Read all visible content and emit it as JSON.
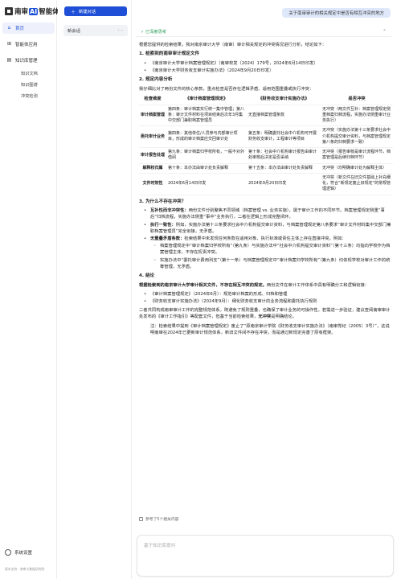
{
  "app": {
    "logo_prefix": "南审",
    "logo_a": "AI",
    "logo_suffix": "智能体"
  },
  "sidebar": {
    "nav": [
      {
        "label": "首页",
        "icon": "home-icon"
      },
      {
        "label": "智能体应用",
        "icon": "apps-icon"
      },
      {
        "label": "知识库管理",
        "icon": "knowledge-icon"
      }
    ],
    "subnav": [
      "知识文档",
      "知识图谱",
      "冲突检测"
    ],
    "settings_label": "系统设置",
    "footer_note": "版本支持：南审大数据研究院"
  },
  "conversations": {
    "new_chat_label": "新建对话",
    "items": [
      {
        "title": "新会话",
        "more": "···"
      }
    ]
  },
  "chat": {
    "user_message": "关于南审审计的相关规定中是否有相互冲突的地方",
    "thinking_label": "已深度思考",
    "intro": "根据您提供的检索结果，我对南京审计大学（南审）审计相关规定的冲突情况进行分析，结论如下：",
    "s1_title": "1. 检索到的南审审计规定文件",
    "s1_items": [
      "《南京审计大学审计档案管理规定》（南审校发〔2024〕179号，2024年6月14日印发）",
      "《南京审计大学财务收支审计实施办法》（2024年9月20日印发）"
    ],
    "s2_title": "2. 规定内容分析",
    "s2_intro": "我仔细比对了两份文件的核心条款，重点检查是否存在逻辑矛盾、适用范围重叠或执行冲突：",
    "table": {
      "headers": [
        "检查维度",
        "《审计档案管理规定》",
        "《财务收支审计实施办法》",
        "是否冲突"
      ],
      "rows": [
        [
          "审计档案管理",
          "第四条：审计档案实行统一集中管理；第八条：审计文件材料在项目结束后次年3月集中交部门兼职档案管理员",
          "无直接档案管理条款",
          "无冲突（两文件互补：档案管理规定侧重档案归档流程，实施办法侧重审计业务执行）"
        ],
        [
          "委托审计业务",
          "第四条：其他单位/人员参与内部审计项目，形成的审计档案应交回审计处",
          "第五条：明确委托社会中介机构可开展财务收支审计，工程审计等项目",
          "无冲突（实施办法第十三条要求社会中介机构提交审计资料，与档案管理规定第八条的归档要求一致）"
        ],
        [
          "审计报告处理",
          "第九条：审计档案归学校所有，一般不对外借阅",
          "第十条：社会中介机构审计报告由审计处审核后决定是否采纳",
          "无冲突（报告审核是审计流程环节，档案管理是后续归档环节）"
        ],
        [
          "解释权归属",
          "第十条：本办法由审计处负责解释",
          "第十五条：本办法由审计处负责解释",
          "无冲突（均明确审计处为解释主体）"
        ],
        [
          "文件时效性",
          "2024年6月14日印发",
          "2024年9月20日印发",
          "无冲突（新文件在旧文件基础上补充细化，符合“新规定废止旧规定”的常规管理逻辑）"
        ]
      ]
    },
    "s3_title": "3. 为什么不存在冲突？",
    "s3_items": [
      {
        "bold": "互补性而非冲突性：",
        "text": "两份文件分别聚焦不同领域（档案管理 vs. 业务实施），属于审计工作的不同环节。档案管理规定侧重“事后”归档流程，实施办法侧重“事中”业务执行，二者在逻辑上形成完整闭环。"
      },
      {
        "bold": "执行一致性：",
        "text": "例如，实施办法第十三条要求社会中介机构提交审计资料，与档案管理规定第八条要求“审计文件材料集中交部门兼职档案管理员”完全衔接，无矛盾。"
      },
      {
        "bold": "无重叠矛盾条款：",
        "text": "检索结果中未发现任何条款在适用对象、执行标准或责任主体上存在直接冲突。例如："
      }
    ],
    "s3_subitems": [
      "档案管理规定中“审计档案归学校所有”（第九条）与实施办法中“社会中介机构提交审计资料”（第十三条）均指向学校作为档案管理主体，不存在权责冲突。",
      "实施办法中“委托审计费用列支”（第十一条）与档案管理规定中“审计档案归学校所有”（第九条）均体现学校对审计工作的统筹管理，无矛盾。"
    ],
    "s4_title": "4. 结论",
    "conclusion_bold": "根据检索到的南京审计大学审计相关文件，不存在相互冲突的规定。",
    "conclusion_text": "两份文件在审计工作体系中具有明确分工和逻辑衔接：",
    "s4_items": [
      "《审计档案管理规定》（2024年6月）：规范审计档案的形成、归档和管理",
      "《财务收支审计实施办法》（2024年9月）：细化财务收支审计的业务流程和委托执行规则"
    ],
    "closing_text": "二者共同构成南审审计工作的完整规范体系，既避免了规则重叠，也确保了审计业务的可操作性。若需进一步验证，建议查阅南审审计处发布的《审计工作指引》等配套文件，但基于当前检索结果，",
    "closing_bold": "无冲突",
    "closing_end": "是明确结论。",
    "note": "注：检索结果中提到《审计档案管理规定》废止了“原南京审计学院《财务收支审计实施办法》（南审党纪〔2005〕3号）”，这说明南审在2024年已更新审计规范体系，新旧文件间不存在冲突，而是通过新规定完善了原有框架。",
    "refs_label": "参考了5个相关内容"
  },
  "input": {
    "placeholder": "基于知识库提问"
  }
}
